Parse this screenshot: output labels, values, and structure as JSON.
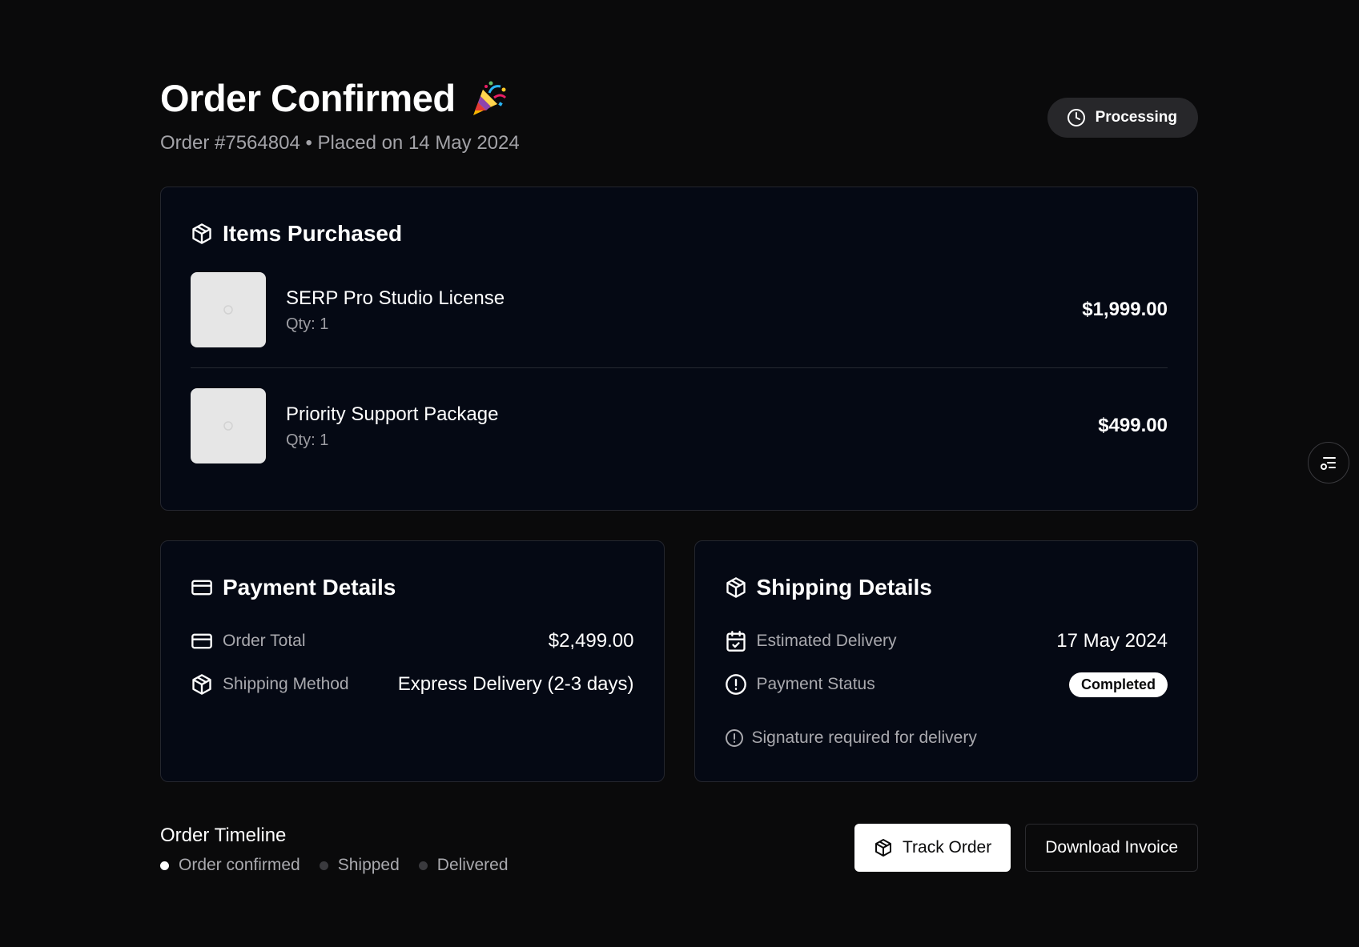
{
  "header": {
    "title": "Order Confirmed",
    "title_icon": "party-popper-icon",
    "subtitle": "Order #7564804 • Placed on 14 May 2024",
    "status_label": "Processing",
    "status_icon": "clock-icon"
  },
  "items_card": {
    "title": "Items Purchased",
    "icon": "package-icon",
    "items": [
      {
        "name": "SERP Pro Studio License",
        "qty": "Qty: 1",
        "price": "$1,999.00"
      },
      {
        "name": "Priority Support Package",
        "qty": "Qty: 1",
        "price": "$499.00"
      }
    ]
  },
  "payment": {
    "title": "Payment Details",
    "icon": "credit-card-icon",
    "rows": [
      {
        "label": "Order Total",
        "value": "$2,499.00",
        "icon": "credit-card-icon"
      },
      {
        "label": "Shipping Method",
        "value": "Express Delivery (2-3 days)",
        "icon": "package-icon"
      }
    ]
  },
  "shipping": {
    "title": "Shipping Details",
    "icon": "package-icon",
    "rows": [
      {
        "label": "Estimated Delivery",
        "value": "17 May 2024",
        "icon": "calendar-check-icon"
      },
      {
        "label": "Payment Status",
        "value": "Completed",
        "icon": "alert-circle-icon"
      }
    ],
    "note": "Signature required for delivery",
    "note_icon": "alert-circle-icon"
  },
  "timeline": {
    "title": "Order Timeline",
    "steps": [
      {
        "label": "Order confirmed",
        "active": true
      },
      {
        "label": "Shipped",
        "active": false
      },
      {
        "label": "Delivered",
        "active": false
      }
    ]
  },
  "actions": {
    "track_label": "Track Order",
    "track_icon": "package-icon",
    "invoice_label": "Download Invoice"
  },
  "floating": {
    "icon": "filter-list-icon"
  },
  "colors": {
    "background": "#0a0a0b",
    "card": "#050914",
    "pill": "#27272a",
    "muted_text": "#a9a9ae"
  }
}
